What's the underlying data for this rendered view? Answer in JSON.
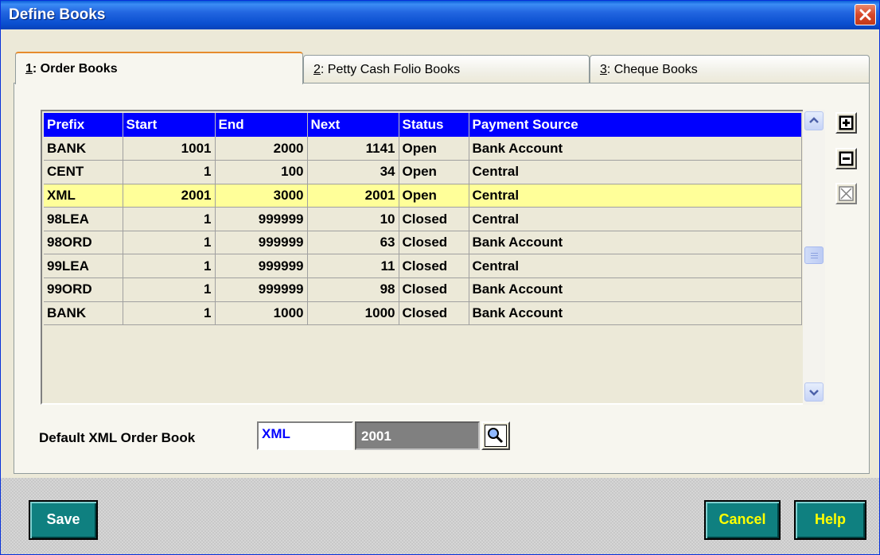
{
  "window": {
    "title": "Define Books"
  },
  "tabs": [
    {
      "key": "1",
      "label": ": Order Books"
    },
    {
      "key": "2",
      "label": ": Petty Cash Folio Books"
    },
    {
      "key": "3",
      "label": ": Cheque Books"
    }
  ],
  "grid": {
    "columns": [
      "Prefix",
      "Start",
      "End",
      "Next",
      "Status",
      "Payment Source"
    ],
    "rows": [
      {
        "prefix": "BANK",
        "start": "1001",
        "end": "2000",
        "next": "1141",
        "status": "Open",
        "source": "Bank Account"
      },
      {
        "prefix": "CENT",
        "start": "1",
        "end": "100",
        "next": "34",
        "status": "Open",
        "source": "Central"
      },
      {
        "prefix": "XML",
        "start": "2001",
        "end": "3000",
        "next": "2001",
        "status": "Open",
        "source": "Central"
      },
      {
        "prefix": "98LEA",
        "start": "1",
        "end": "999999",
        "next": "10",
        "status": "Closed",
        "source": "Central"
      },
      {
        "prefix": "98ORD",
        "start": "1",
        "end": "999999",
        "next": "63",
        "status": "Closed",
        "source": "Bank Account"
      },
      {
        "prefix": "99LEA",
        "start": "1",
        "end": "999999",
        "next": "11",
        "status": "Closed",
        "source": "Central"
      },
      {
        "prefix": "99ORD",
        "start": "1",
        "end": "999999",
        "next": "98",
        "status": "Closed",
        "source": "Bank Account"
      },
      {
        "prefix": "BANK",
        "start": "1",
        "end": "1000",
        "next": "1000",
        "status": "Closed",
        "source": "Bank Account"
      }
    ],
    "selected_row": 2
  },
  "default_book": {
    "label": "Default XML Order Book",
    "prefix_value": "XML",
    "number_value": "2001"
  },
  "buttons": {
    "save": "Save",
    "cancel": "Cancel",
    "help": "Help"
  },
  "icons": {
    "add": "plus-icon",
    "remove": "minus-icon",
    "delete": "cross-box-icon",
    "lookup": "magnifier-icon"
  },
  "colors": {
    "header_bg": "#0000ff",
    "selected_row": "#ffff99",
    "action_button_bg": "#0f8080",
    "action_button_text": "#ffff00"
  }
}
